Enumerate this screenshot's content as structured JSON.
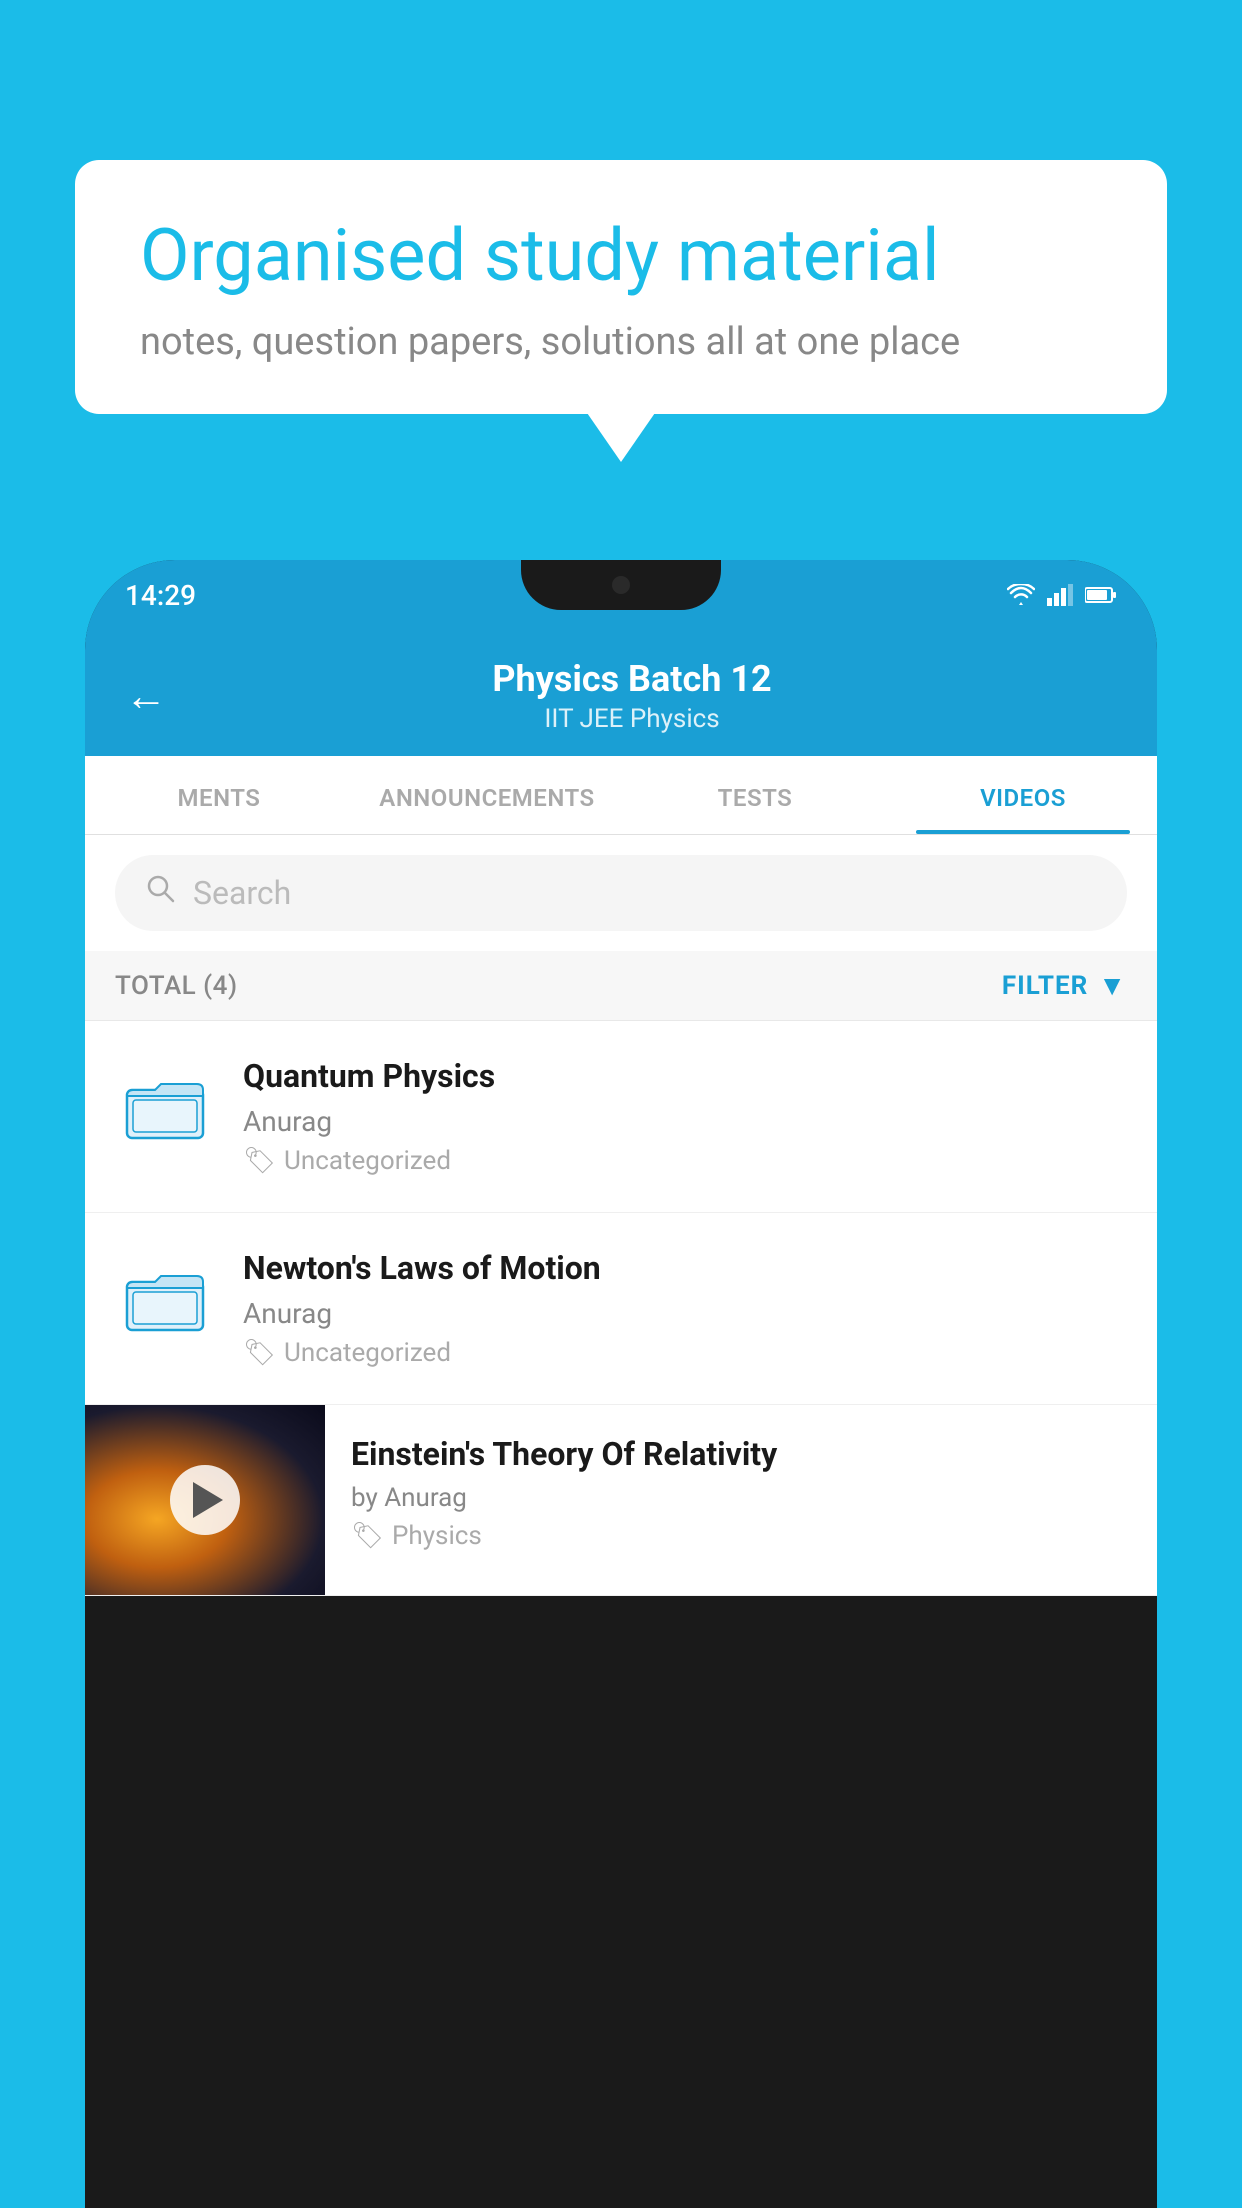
{
  "background_color": "#1BBCE8",
  "speech_bubble": {
    "title": "Organised study material",
    "subtitle": "notes, question papers, solutions all at one place"
  },
  "phone": {
    "status_bar": {
      "time": "14:29",
      "icons": [
        "wifi",
        "signal",
        "battery"
      ]
    },
    "header": {
      "back_label": "←",
      "title": "Physics Batch 12",
      "subtitle": "IIT JEE   Physics"
    },
    "tabs": [
      {
        "label": "MENTS",
        "active": false
      },
      {
        "label": "ANNOUNCEMENTS",
        "active": false
      },
      {
        "label": "TESTS",
        "active": false
      },
      {
        "label": "VIDEOS",
        "active": true
      }
    ],
    "search": {
      "placeholder": "Search"
    },
    "filter_bar": {
      "total_label": "TOTAL (4)",
      "filter_label": "FILTER"
    },
    "videos": [
      {
        "id": 1,
        "title": "Quantum Physics",
        "author": "Anurag",
        "tag": "Uncategorized",
        "has_thumbnail": false
      },
      {
        "id": 2,
        "title": "Newton's Laws of Motion",
        "author": "Anurag",
        "tag": "Uncategorized",
        "has_thumbnail": false
      },
      {
        "id": 3,
        "title": "Einstein's Theory Of Relativity",
        "author": "by Anurag",
        "tag": "Physics",
        "has_thumbnail": true
      }
    ]
  }
}
